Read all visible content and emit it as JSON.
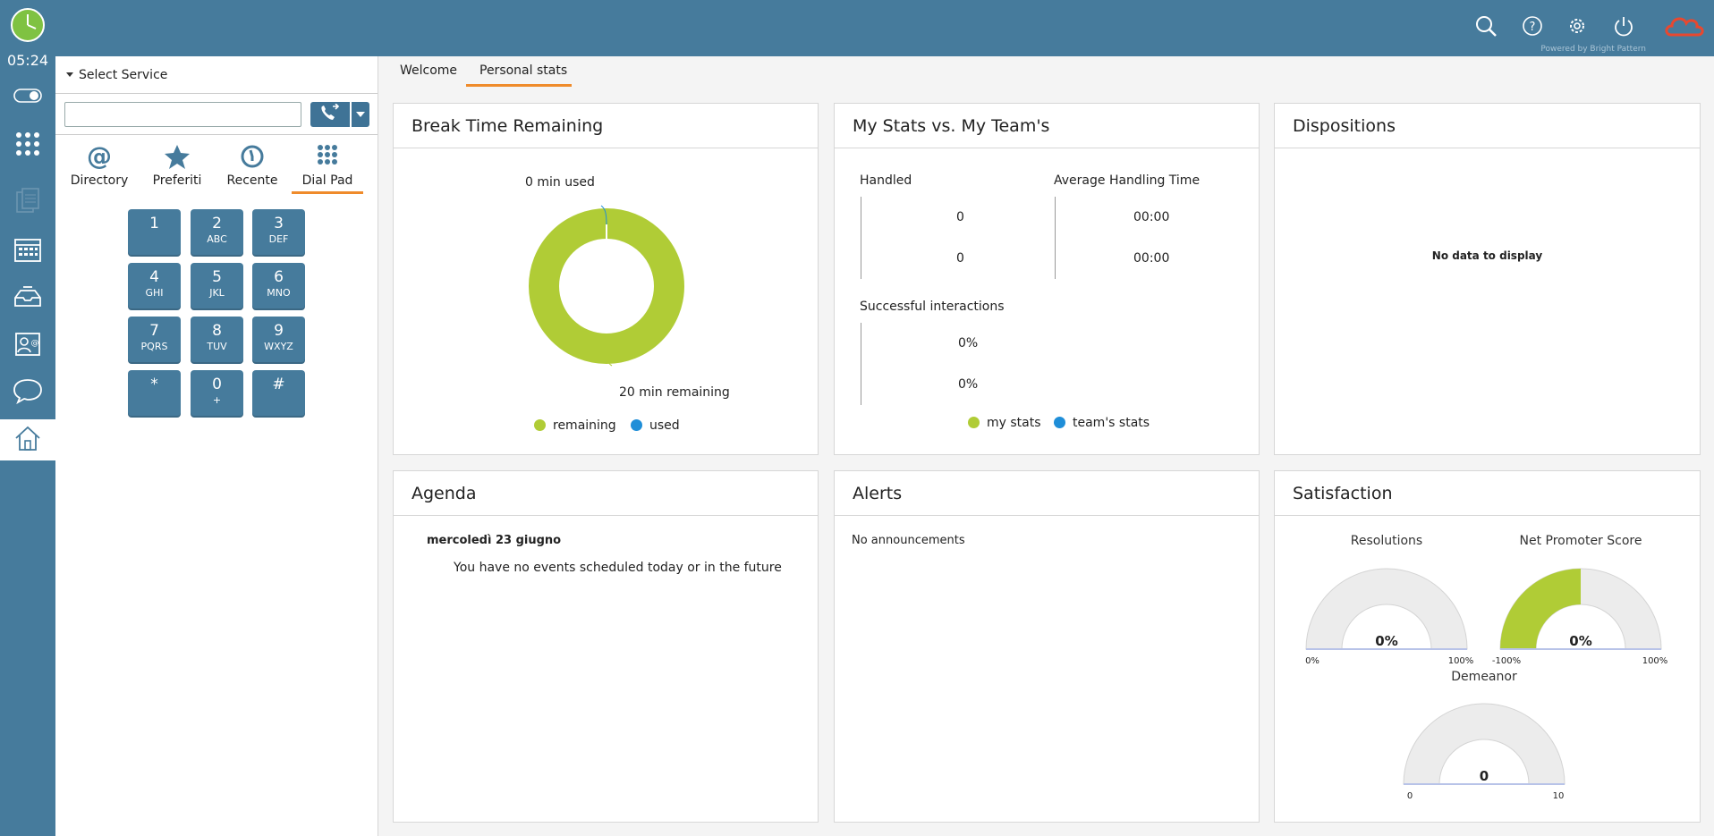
{
  "rail": {
    "time": "05:24",
    "items": [
      "toggle",
      "apps",
      "documents",
      "calendar",
      "inbox",
      "contacts",
      "chat",
      "home"
    ]
  },
  "topbar": {
    "powered_by": "Powered by Bright Pattern"
  },
  "dialer": {
    "service_label": "Select Service",
    "input_value": "",
    "tabs": [
      {
        "label": "Directory",
        "icon": "at-icon"
      },
      {
        "label": "Preferiti",
        "icon": "star-icon"
      },
      {
        "label": "Recente",
        "icon": "history-icon"
      },
      {
        "label": "Dial Pad",
        "icon": "dialpad-icon"
      }
    ],
    "keys": [
      {
        "num": "1",
        "letters": ""
      },
      {
        "num": "2",
        "letters": "ABC"
      },
      {
        "num": "3",
        "letters": "DEF"
      },
      {
        "num": "4",
        "letters": "GHI"
      },
      {
        "num": "5",
        "letters": "JKL"
      },
      {
        "num": "6",
        "letters": "MNO"
      },
      {
        "num": "7",
        "letters": "PQRS"
      },
      {
        "num": "8",
        "letters": "TUV"
      },
      {
        "num": "9",
        "letters": "WXYZ"
      },
      {
        "num": "*",
        "letters": ""
      },
      {
        "num": "0",
        "letters": "+"
      },
      {
        "num": "#",
        "letters": ""
      }
    ]
  },
  "main": {
    "tabs": [
      {
        "label": "Welcome"
      },
      {
        "label": "Personal stats"
      }
    ],
    "active_tab": "Personal stats"
  },
  "widgets": {
    "break_time": {
      "title": "Break Time Remaining",
      "used_label": "0 min used",
      "remaining_label": "20 min remaining",
      "legend_remaining": "remaining",
      "legend_used": "used"
    },
    "my_stats": {
      "title": "My Stats vs. My Team's",
      "handled_label": "Handled",
      "handled_mine": "0",
      "handled_team": "0",
      "aht_label": "Average Handling Time",
      "aht_mine": "00:00",
      "aht_team": "00:00",
      "success_label": "Successful interactions",
      "success_mine": "0%",
      "success_team": "0%",
      "legend_my": "my stats",
      "legend_team": "team's stats"
    },
    "dispositions": {
      "title": "Dispositions",
      "empty": "No data to display"
    },
    "agenda": {
      "title": "Agenda",
      "date": "mercoledì 23 giugno",
      "message": "You have no events scheduled today or in the future"
    },
    "alerts": {
      "title": "Alerts",
      "message": "No announcements"
    },
    "satisfaction": {
      "title": "Satisfaction",
      "gauges": [
        {
          "label": "Resolutions",
          "value": "0%",
          "min": "0%",
          "max": "100%",
          "fill": 0
        },
        {
          "label": "Net Promoter Score",
          "value": "0%",
          "min": "-100%",
          "max": "100%",
          "fill": 0.5
        },
        {
          "label": "Demeanor",
          "value": "0",
          "min": "0",
          "max": "10",
          "fill": 0
        }
      ]
    }
  },
  "chart_data": {
    "type": "pie",
    "categories": [
      "remaining",
      "used"
    ],
    "values": [
      20,
      0
    ],
    "colors": {
      "remaining": "#b0cc36",
      "used": "#1f8ed8"
    }
  },
  "colors": {
    "brand": "#467b9c",
    "accent": "#ef8b2b",
    "green": "#b0cc36",
    "blue": "#1f8ed8"
  }
}
